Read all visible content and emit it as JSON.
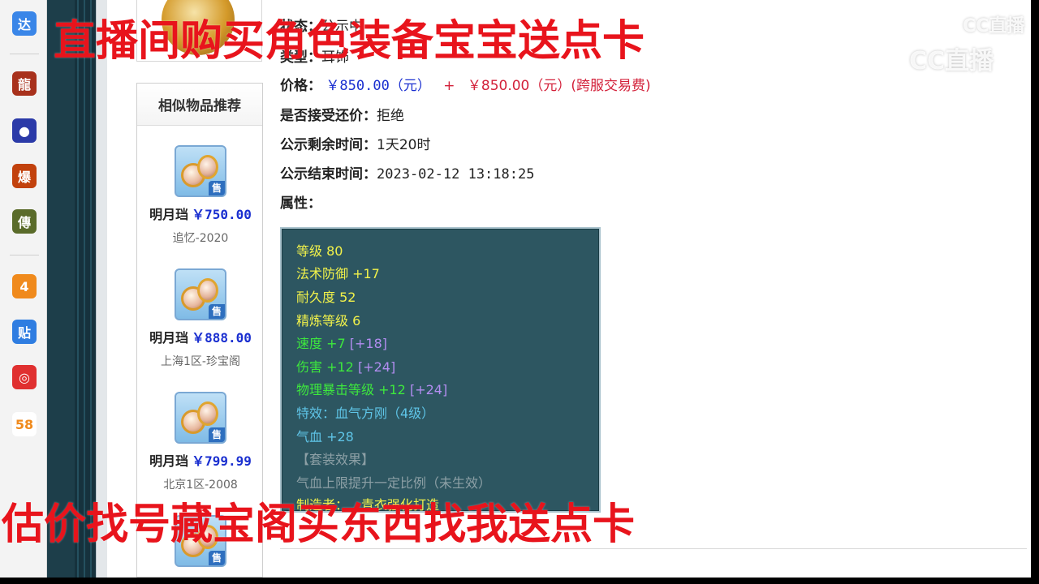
{
  "overlays": {
    "top_text": "直播间购买角色装备宝宝送点卡",
    "bottom_text": "估价找号藏宝阁买东西找我送点卡",
    "logo_top": "CC直播",
    "logo_main": "CC直播"
  },
  "appbar": {
    "items": [
      {
        "icon": "da-app-icon",
        "glyph": "达",
        "color": "#3a86e8"
      },
      {
        "icon": "dragon-game-icon",
        "glyph": "龍",
        "color": "#a8311c"
      },
      {
        "icon": "ball-game-icon",
        "glyph": "●",
        "color": "#2b3aa8"
      },
      {
        "icon": "bao-game-icon",
        "glyph": "爆",
        "color": "#c2410c"
      },
      {
        "icon": "legend-game-icon",
        "glyph": "傳",
        "color": "#5a6b2a"
      },
      {
        "icon": "4399-icon",
        "glyph": "4",
        "color": "#f08a1c"
      },
      {
        "icon": "tieba-icon",
        "glyph": "贴",
        "color": "#2f7de1"
      },
      {
        "icon": "netease-music-icon",
        "glyph": "◎",
        "color": "#e03030"
      },
      {
        "icon": "58-icon",
        "glyph": "58",
        "color": "#ffffff"
      }
    ]
  },
  "info": {
    "status_label": "状态：",
    "status_value": "公示中",
    "type_label": "类型：",
    "type_value": "耳饰",
    "price_label": "价格：",
    "price_value": "￥850.00（元）",
    "price_plus": "+",
    "price_cross": "￥850.00（元）(跨服交易费)",
    "bargain_label": "是否接受还价：",
    "bargain_value": "拒绝",
    "remain_label": "公示剩余时间：",
    "remain_value": "1天20时",
    "end_label": "公示结束时间：",
    "end_value": "2023-02-12 13:18:25",
    "attr_label": "属性："
  },
  "attributes": {
    "level": "等级 80",
    "magic_def": "法术防御 +17",
    "durability": "耐久度 52",
    "refine": "精炼等级 6",
    "speed": "速度 +7",
    "speed_bonus": "[+18]",
    "damage": "伤害 +12",
    "damage_bonus": "[+24]",
    "crit": "物理暴击等级 +12",
    "crit_bonus": "[+24]",
    "effect": "特效：血气方刚（4级）",
    "hp": "气血 +28",
    "set_title": "【套装效果】",
    "set_desc": "气血上限提升一定比例（未生效）",
    "maker": "制造者：…青衣强化打造"
  },
  "similar": {
    "title": "相似物品推荐",
    "items": [
      {
        "name": "明月珰",
        "price": "￥750.00",
        "server": "追忆-2020",
        "badge": "售"
      },
      {
        "name": "明月珰",
        "price": "￥888.00",
        "server": "上海1区-珍宝阁",
        "badge": "售"
      },
      {
        "name": "明月珰",
        "price": "￥799.99",
        "server": "北京1区-2008",
        "badge": "售"
      },
      {
        "name": "",
        "price": "",
        "server": "",
        "badge": "售"
      }
    ]
  }
}
